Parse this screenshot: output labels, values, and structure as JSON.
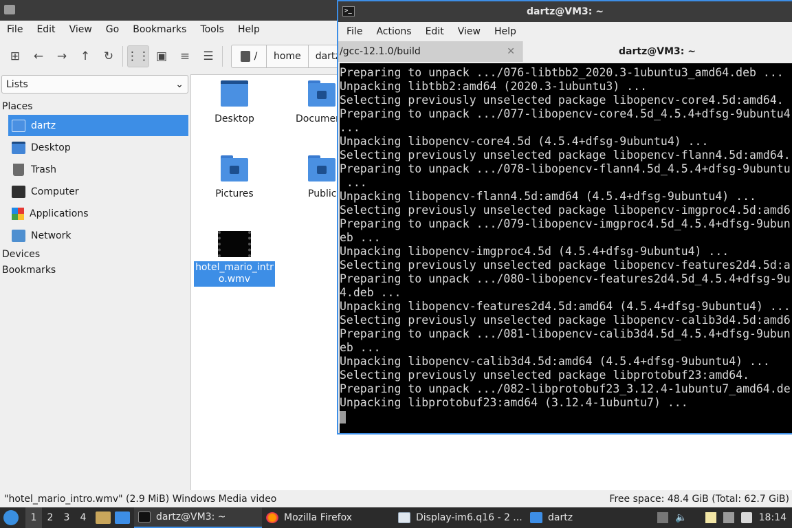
{
  "file_manager": {
    "menu": [
      "File",
      "Edit",
      "View",
      "Go",
      "Bookmarks",
      "Tools",
      "Help"
    ],
    "path": {
      "root": "/",
      "crumbs": [
        "home",
        "dartz"
      ]
    },
    "side_selector": "Lists",
    "places_heading": "Places",
    "places": [
      {
        "label": "dartz",
        "icon": "home-folder-icon",
        "selected": true
      },
      {
        "label": "Desktop",
        "icon": "desktop-icon"
      },
      {
        "label": "Trash",
        "icon": "trash-icon"
      },
      {
        "label": "Computer",
        "icon": "computer-icon"
      },
      {
        "label": "Applications",
        "icon": "applications-icon"
      },
      {
        "label": "Network",
        "icon": "network-icon"
      }
    ],
    "devices_heading": "Devices",
    "bookmarks_heading": "Bookmarks",
    "files": [
      {
        "label": "Desktop",
        "icon": "desktop-folder-icon"
      },
      {
        "label": "Documen",
        "icon": "documents-folder-icon"
      },
      {
        "label": "Pictures",
        "icon": "pictures-folder-icon"
      },
      {
        "label": "Public",
        "icon": "public-folder-icon"
      },
      {
        "label": "hotel_mario_intro.wmv",
        "icon": "video-thumbnail",
        "selected": true
      }
    ],
    "status_left": "\"hotel_mario_intro.wmv\" (2.9 MiB) Windows Media video",
    "status_right": "Free space: 48.4 GiB (Total: 62.7 GiB)"
  },
  "terminal": {
    "title": "dartz@VM3: ~",
    "menu": [
      "File",
      "Actions",
      "Edit",
      "View",
      "Help"
    ],
    "tabs": [
      {
        "label": "/gcc-12.1.0/build",
        "active": false
      },
      {
        "label": "dartz@VM3: ~",
        "active": true
      }
    ],
    "lines": [
      "Preparing to unpack .../076-libtbb2_2020.3-1ubuntu3_amd64.deb ...",
      "Unpacking libtbb2:amd64 (2020.3-1ubuntu3) ...",
      "Selecting previously unselected package libopencv-core4.5d:amd64.",
      "Preparing to unpack .../077-libopencv-core4.5d_4.5.4+dfsg-9ubuntu4",
      "...",
      "Unpacking libopencv-core4.5d (4.5.4+dfsg-9ubuntu4) ...",
      "Selecting previously unselected package libopencv-flann4.5d:amd64.",
      "Preparing to unpack .../078-libopencv-flann4.5d_4.5.4+dfsg-9ubuntu",
      " ...",
      "Unpacking libopencv-flann4.5d:amd64 (4.5.4+dfsg-9ubuntu4) ...",
      "Selecting previously unselected package libopencv-imgproc4.5d:amd6",
      "Preparing to unpack .../079-libopencv-imgproc4.5d_4.5.4+dfsg-9ubun",
      "eb ...",
      "Unpacking libopencv-imgproc4.5d (4.5.4+dfsg-9ubuntu4) ...",
      "Selecting previously unselected package libopencv-features2d4.5d:a",
      "Preparing to unpack .../080-libopencv-features2d4.5d_4.5.4+dfsg-9u",
      "4.deb ...",
      "Unpacking libopencv-features2d4.5d:amd64 (4.5.4+dfsg-9ubuntu4) ...",
      "Selecting previously unselected package libopencv-calib3d4.5d:amd6",
      "Preparing to unpack .../081-libopencv-calib3d4.5d_4.5.4+dfsg-9ubun",
      "eb ...",
      "Unpacking libopencv-calib3d4.5d:amd64 (4.5.4+dfsg-9ubuntu4) ...",
      "Selecting previously unselected package libprotobuf23:amd64.",
      "Preparing to unpack .../082-libprotobuf23_3.12.4-1ubuntu7_amd64.de",
      "Unpacking libprotobuf23:amd64 (3.12.4-1ubuntu7) ..."
    ]
  },
  "taskbar": {
    "workspaces": [
      "1",
      "2",
      "3",
      "4"
    ],
    "tasks": [
      {
        "label": "dartz@VM3: ~",
        "icon": "terminal-icon",
        "active": true
      },
      {
        "label": "Mozilla Firefox",
        "icon": "firefox-icon"
      },
      {
        "label": "Display-im6.q16 - 2 ...",
        "icon": "image-viewer-icon"
      },
      {
        "label": "dartz",
        "icon": "folder-icon"
      }
    ],
    "clock": "18:14"
  }
}
